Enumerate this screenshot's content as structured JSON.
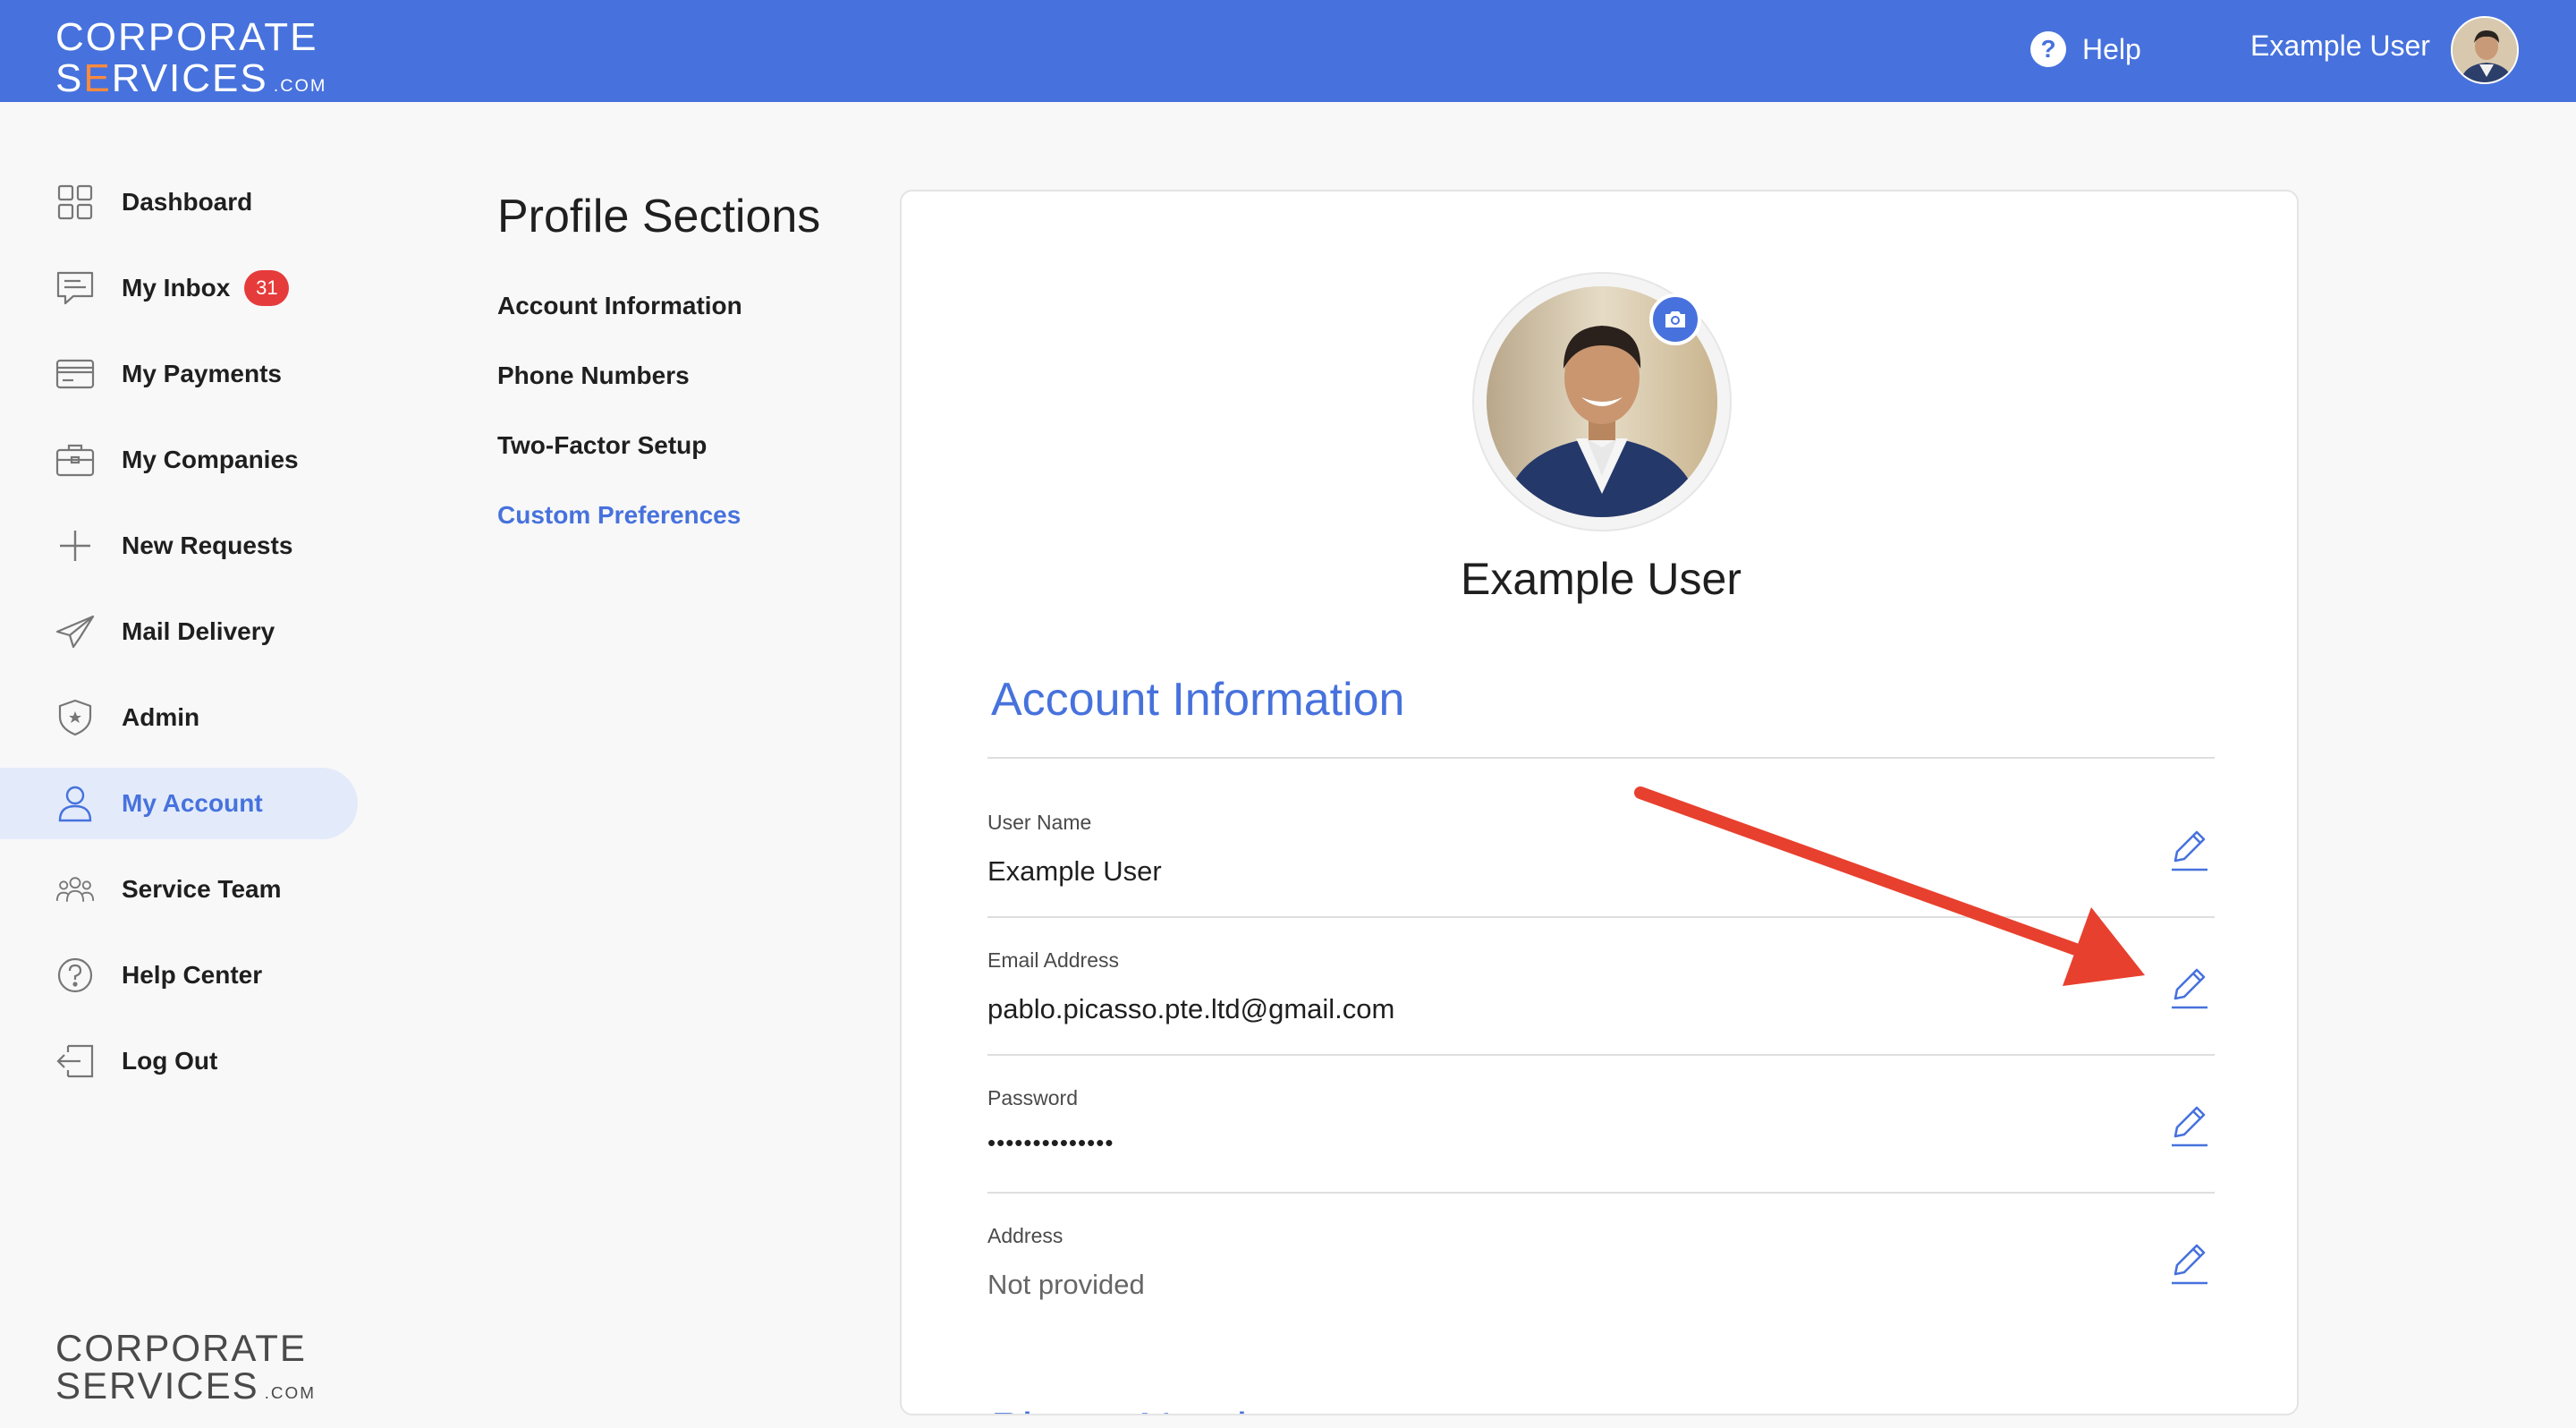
{
  "header": {
    "logo_line1": "CORPORATE",
    "logo_line2_s": "S",
    "logo_line2_e": "E",
    "logo_line2_rest": "RVICES",
    "logo_dotcom": ".COM",
    "help_label": "Help",
    "user_name": "Example User"
  },
  "sidebar": {
    "items": [
      {
        "label": "Dashboard",
        "icon": "grid-icon"
      },
      {
        "label": "My Inbox",
        "icon": "chat-icon",
        "badge": "31"
      },
      {
        "label": "My Payments",
        "icon": "card-icon"
      },
      {
        "label": "My Companies",
        "icon": "briefcase-icon"
      },
      {
        "label": "New Requests",
        "icon": "plus-icon"
      },
      {
        "label": "Mail Delivery",
        "icon": "paper-plane-icon"
      },
      {
        "label": "Admin",
        "icon": "shield-icon"
      },
      {
        "label": "My Account",
        "icon": "user-icon",
        "active": true
      },
      {
        "label": "Service Team",
        "icon": "team-icon"
      },
      {
        "label": "Help Center",
        "icon": "question-icon"
      },
      {
        "label": "Log Out",
        "icon": "logout-icon"
      }
    ],
    "bottom_logo_line1": "CORPORATE",
    "bottom_logo_line2": "SERVICES",
    "bottom_logo_dotcom": ".COM"
  },
  "profile_sections": {
    "title": "Profile Sections",
    "links": [
      "Account Information",
      "Phone Numbers",
      "Two-Factor Setup",
      "Custom Preferences"
    ],
    "active_link": "Custom Preferences"
  },
  "card": {
    "user_name": "Example User",
    "account_title": "Account Information",
    "fields": [
      {
        "label": "User Name",
        "value": "Example User"
      },
      {
        "label": "Email Address",
        "value": "pablo.picasso.pte.ltd@gmail.com"
      },
      {
        "label": "Password",
        "value": "••••••••••••••"
      },
      {
        "label": "Address",
        "value": "Not provided"
      }
    ],
    "next_section_title": "Phone Numbers"
  },
  "colors": {
    "brand": "#4772dd",
    "badge": "#e63b3b",
    "annotation_arrow": "#e8402e",
    "logo_accent": "#ff8a3c"
  }
}
